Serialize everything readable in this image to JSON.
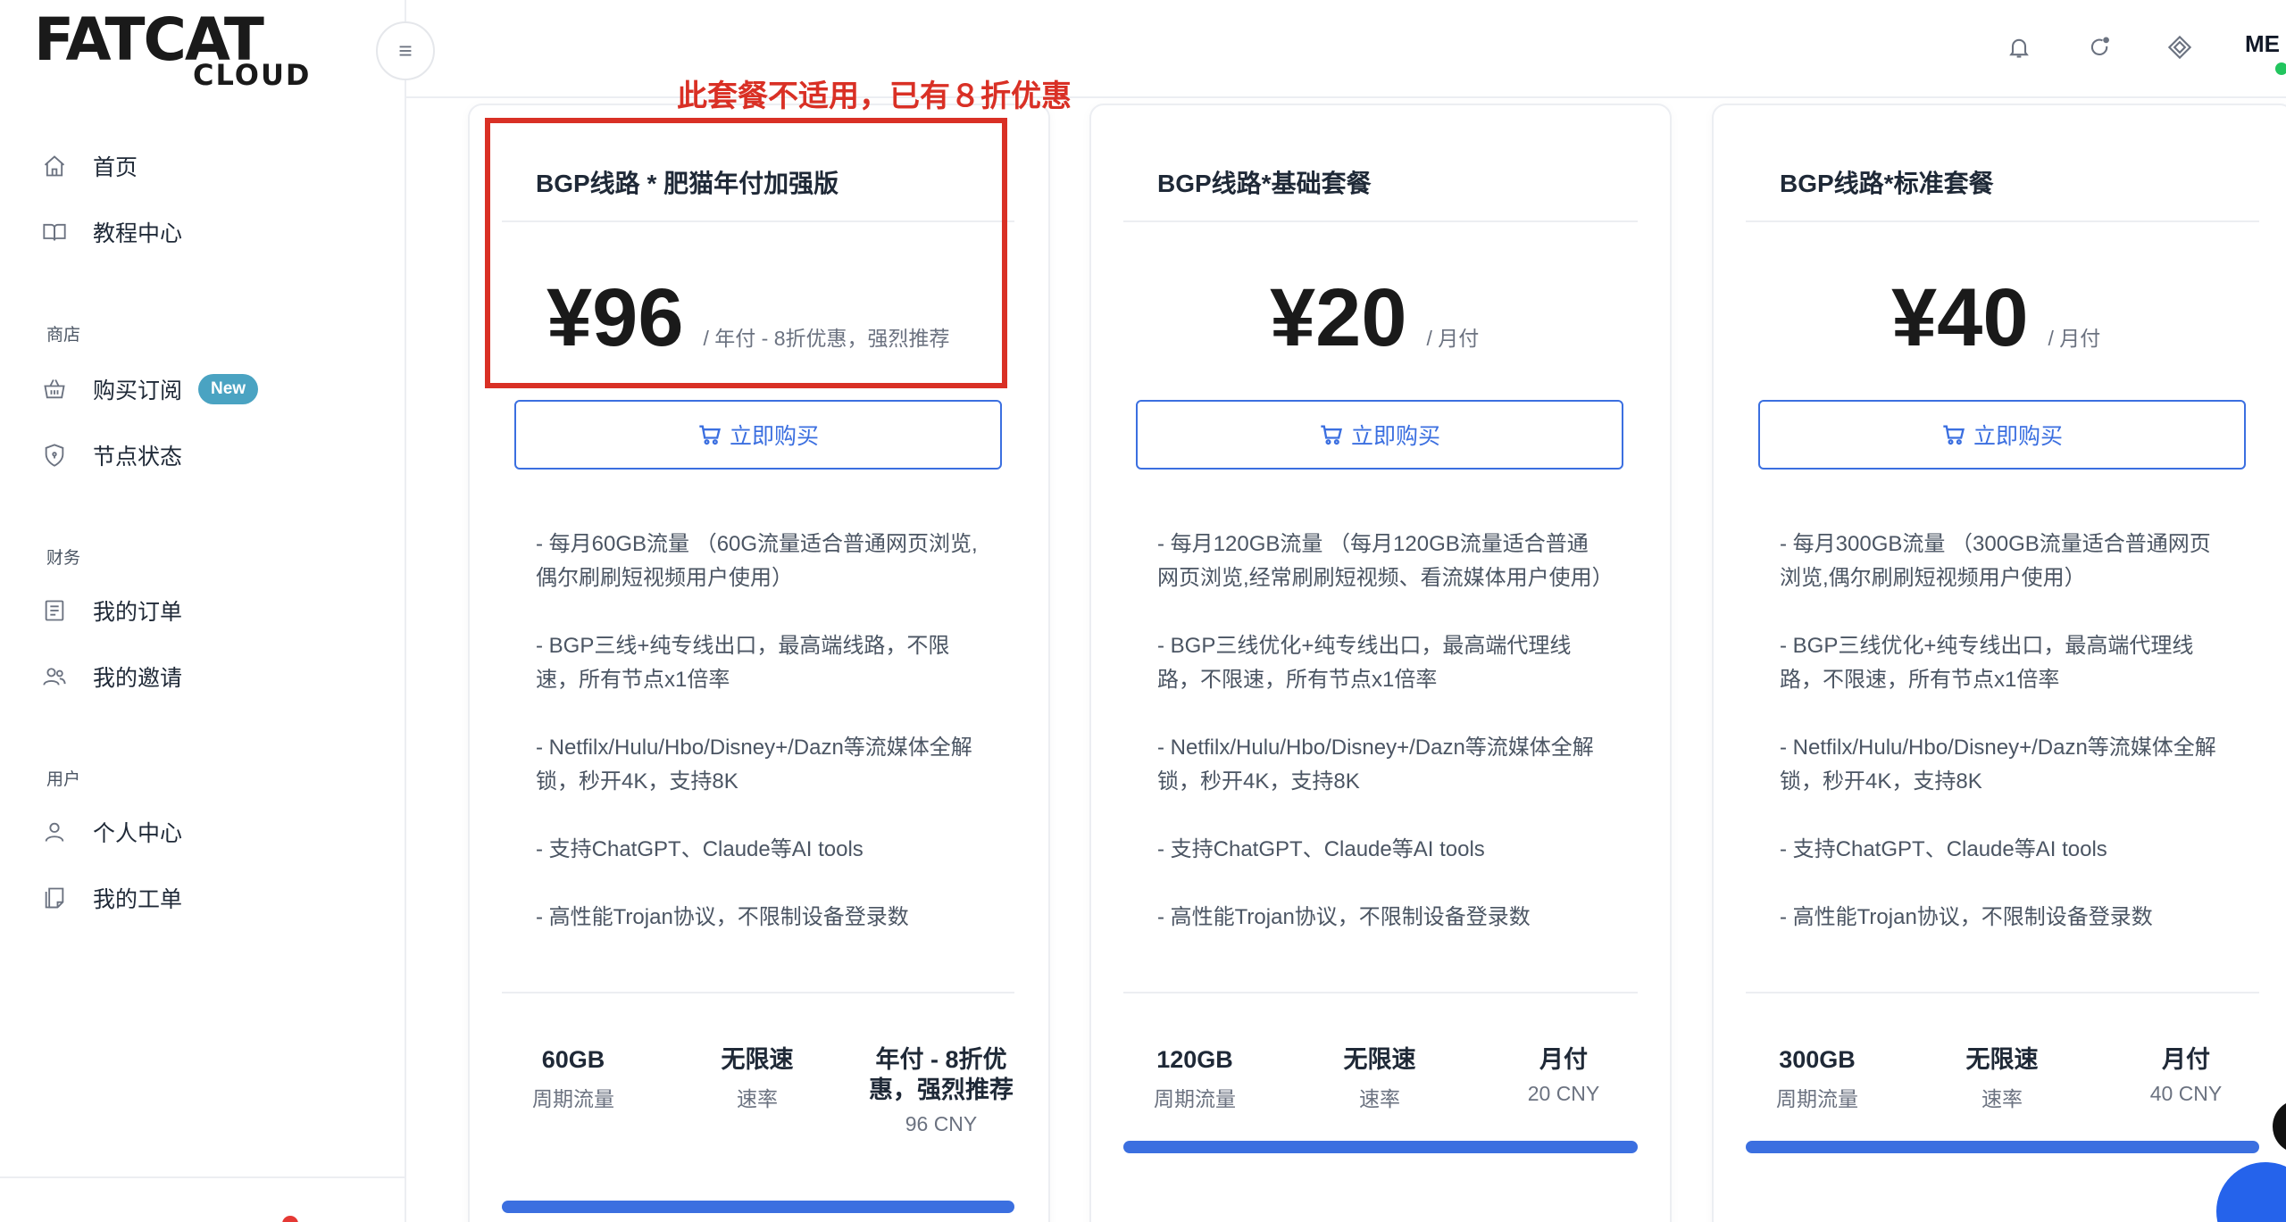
{
  "logo": {
    "main": "FATCAT",
    "sub": "CLOUD"
  },
  "sidebar": {
    "items_top": [
      {
        "label": "首页",
        "icon": "home-icon"
      },
      {
        "label": "教程中心",
        "icon": "book-icon"
      }
    ],
    "sections": [
      {
        "title": "商店",
        "items": [
          {
            "label": "购买订阅",
            "icon": "basket-icon",
            "badge": "New"
          },
          {
            "label": "节点状态",
            "icon": "shield-icon"
          }
        ]
      },
      {
        "title": "财务",
        "items": [
          {
            "label": "我的订单",
            "icon": "receipt-icon"
          },
          {
            "label": "我的邀请",
            "icon": "users-icon"
          }
        ]
      },
      {
        "title": "用户",
        "items": [
          {
            "label": "个人中心",
            "icon": "user-icon"
          },
          {
            "label": "我的工单",
            "icon": "ticket-icon"
          }
        ]
      }
    ]
  },
  "header": {
    "avatar": "ME",
    "icons": [
      "bell-icon",
      "refresh-icon",
      "diamond-icon"
    ]
  },
  "annotation": {
    "text": "此套餐不适用，已有８折优惠",
    "color": "#d93025"
  },
  "plans": [
    {
      "title": "BGP线路 * 肥猫年付加强版",
      "price": "¥96",
      "price_note": "/ 年付 - 8折优惠，强烈推荐",
      "buy_label": "立即购买",
      "features": [
        "- 每月60GB流量 （60G流量适合普通网页浏览,偶尔刷刷短视频用户使用）",
        "- BGP三线+纯专线出口，最高端线路，不限速，所有节点x1倍率",
        "- Netfilx/Hulu/Hbo/Disney+/Dazn等流媒体全解锁，秒开4K，支持8K",
        "- 支持ChatGPT、Claude等AI tools",
        "- 高性能Trojan协议，不限制设备登录数"
      ],
      "stats": [
        {
          "value": "60GB",
          "label": "周期流量"
        },
        {
          "value": "无限速",
          "label": "速率"
        },
        {
          "value": "年付 - 8折优惠，强烈推荐",
          "label": "96 CNY"
        }
      ]
    },
    {
      "title": "BGP线路*基础套餐",
      "price": "¥20",
      "price_note": "/ 月付",
      "buy_label": "立即购买",
      "features": [
        "- 每月120GB流量 （每月120GB流量适合普通网页浏览,经常刷刷短视频、看流媒体用户使用）",
        "- BGP三线优化+纯专线出口，最高端代理线路，不限速，所有节点x1倍率",
        "- Netfilx/Hulu/Hbo/Disney+/Dazn等流媒体全解锁，秒开4K，支持8K",
        "- 支持ChatGPT、Claude等AI tools",
        "- 高性能Trojan协议，不限制设备登录数"
      ],
      "stats": [
        {
          "value": "120GB",
          "label": "周期流量"
        },
        {
          "value": "无限速",
          "label": "速率"
        },
        {
          "value": "月付",
          "label": "20 CNY"
        }
      ]
    },
    {
      "title": "BGP线路*标准套餐",
      "price": "¥40",
      "price_note": "/ 月付",
      "buy_label": "立即购买",
      "features": [
        "- 每月300GB流量 （300GB流量适合普通网页浏览,偶尔刷刷短视频用户使用）",
        "- BGP三线优化+纯专线出口，最高端代理线路，不限速，所有节点x1倍率",
        "- Netfilx/Hulu/Hbo/Disney+/Dazn等流媒体全解锁，秒开4K，支持8K",
        "- 支持ChatGPT、Claude等AI tools",
        "- 高性能Trojan协议，不限制设备登录数"
      ],
      "stats": [
        {
          "value": "300GB",
          "label": "周期流量"
        },
        {
          "value": "无限速",
          "label": "速率"
        },
        {
          "value": "月付",
          "label": "40 CNY"
        }
      ]
    }
  ],
  "colors": {
    "accent": "#3b6fe0",
    "badge": "#4aa3c2",
    "annotation": "#d93025"
  }
}
